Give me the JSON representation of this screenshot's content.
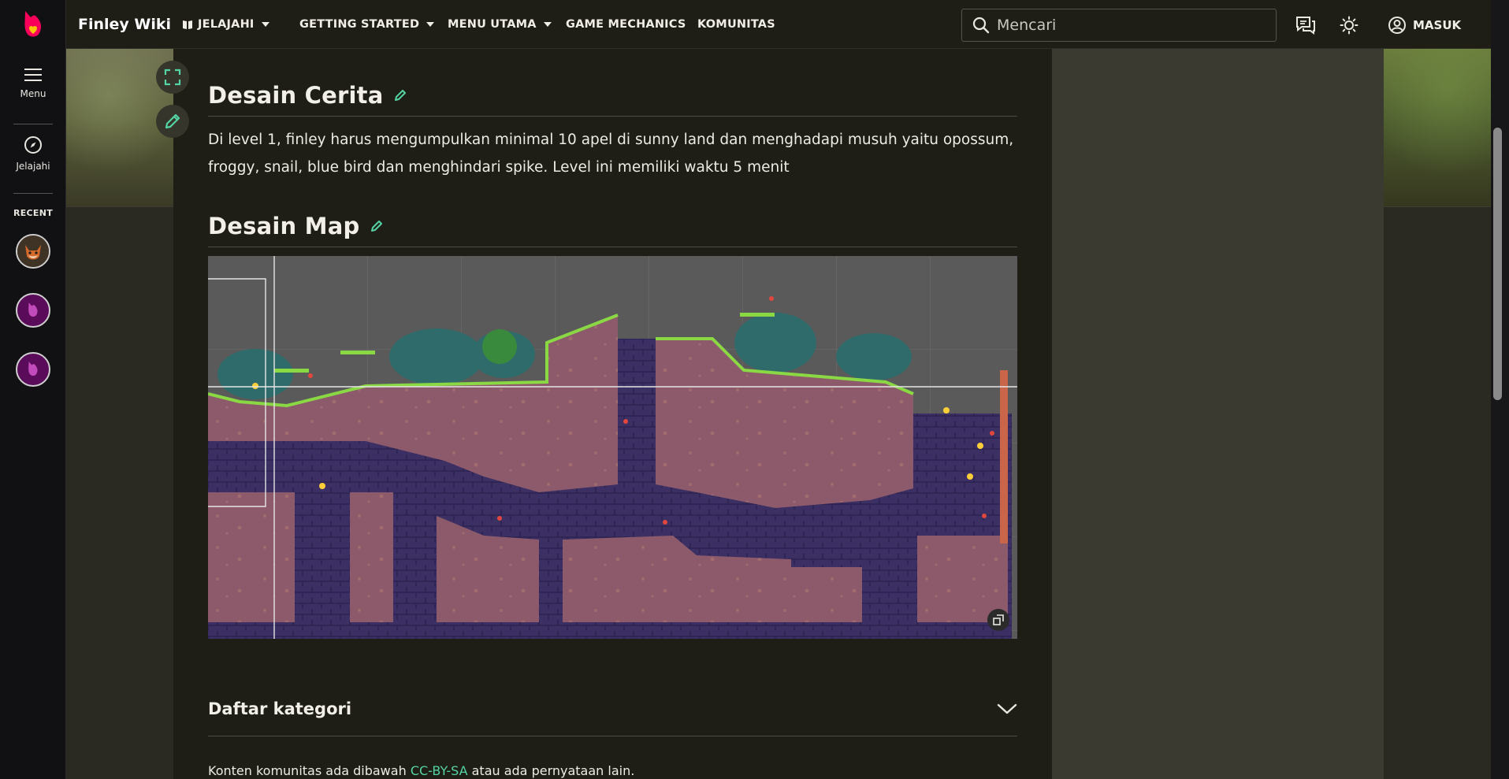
{
  "nav": {
    "brand": "Finley Wiki",
    "items": [
      {
        "label": "JELAJAHI",
        "dropdown": true
      },
      {
        "label": "GETTING STARTED",
        "dropdown": true
      },
      {
        "label": "MENU UTAMA",
        "dropdown": true
      },
      {
        "label": "GAME MECHANICS",
        "dropdown": false
      },
      {
        "label": "KOMUNITAS",
        "dropdown": false
      }
    ],
    "search_placeholder": "Mencari",
    "signin_label": "MASUK"
  },
  "rail": {
    "menu_label": "Menu",
    "explore_label": "Jelajahi",
    "recent_label": "RECENT"
  },
  "sections": {
    "cerita": {
      "title": "Desain Cerita",
      "text": "Di level 1, finley harus mengumpulkan minimal 10 apel di sunny land dan menghadapi musuh yaitu opossum, froggy, snail, blue bird dan menghindari spike. Level ini memiliki waktu 5 menit"
    },
    "map": {
      "title": "Desain Map"
    }
  },
  "categories": {
    "title": "Daftar kategori"
  },
  "license": {
    "prefix": "Konten komunitas ada dibawah",
    "link": "CC-BY-SA",
    "suffix": "atau ada pernyataan lain."
  },
  "colors": {
    "accent": "#54d3a4",
    "brand": "#fa005a",
    "fandom_purple": "#5a0c5a",
    "page_bg": "#1f1e16"
  }
}
